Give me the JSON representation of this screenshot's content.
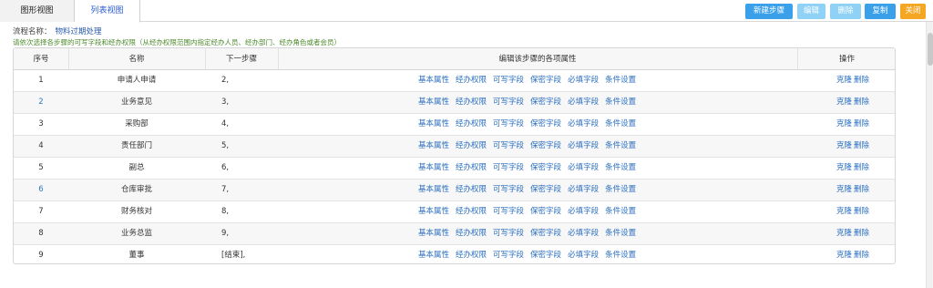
{
  "tabs": [
    {
      "label": "图形视图"
    },
    {
      "label": "列表视图"
    }
  ],
  "toolbar": {
    "new_label": "新建步骤",
    "edit_label": "编辑",
    "delete_label": "删除",
    "copy_label": "复制",
    "close_label": "关闭"
  },
  "info": {
    "flow_label": "流程名称：",
    "flow_name": "物料过期处理",
    "hint": "请依次选择各步骤的可写字段和经办权限（从经办权限范围内指定经办人员、经办部门、经办角色或者会员）"
  },
  "table": {
    "headers": [
      "序号",
      "名称",
      "下一步骤",
      "编辑该步骤的各项属性",
      "操作"
    ],
    "attr_links": [
      "基本属性",
      "经办权限",
      "可写字段",
      "保密字段",
      "必填字段",
      "条件设置"
    ],
    "op_links": [
      "克隆",
      "删除"
    ],
    "rows": [
      {
        "idx": "1",
        "name": "申请人申请",
        "next": "2,"
      },
      {
        "idx": "2",
        "name": "业务意见",
        "next": "3,"
      },
      {
        "idx": "3",
        "name": "采购部",
        "next": "4,"
      },
      {
        "idx": "4",
        "name": "责任部门",
        "next": "5,"
      },
      {
        "idx": "5",
        "name": "副总",
        "next": "6,"
      },
      {
        "idx": "6",
        "name": "仓库审批",
        "next": "7,"
      },
      {
        "idx": "7",
        "name": "财务核对",
        "next": "8,"
      },
      {
        "idx": "8",
        "name": "业务总监",
        "next": "9,"
      },
      {
        "idx": "9",
        "name": "董事",
        "next": "[结束],"
      }
    ]
  }
}
